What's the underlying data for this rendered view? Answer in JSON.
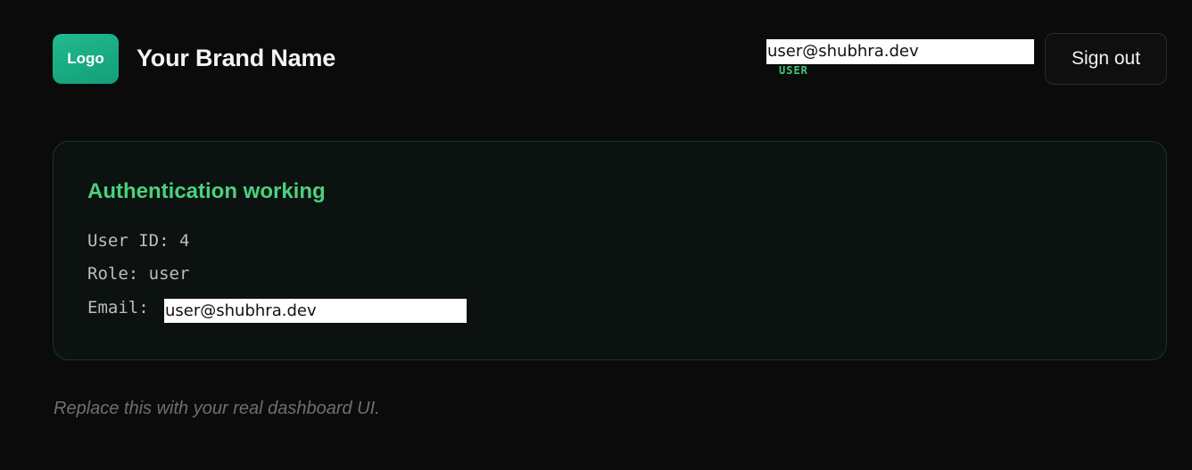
{
  "header": {
    "logo_text": "Logo",
    "brand_name": "Your Brand Name",
    "user_email": "user@shubhra.dev",
    "user_role": "USER",
    "signout_label": "Sign out"
  },
  "card": {
    "title": "Authentication working",
    "user_id_line": "User ID: 4",
    "role_line": "Role: user",
    "email_label": "Email:",
    "email_value": "user@shubhra.dev"
  },
  "footnote": "Replace this with your real dashboard UI.",
  "colors": {
    "background": "#0b0b0c",
    "accent_green": "#4cd07e",
    "logo_green": "#1aad84",
    "card_border": "#16392a"
  }
}
